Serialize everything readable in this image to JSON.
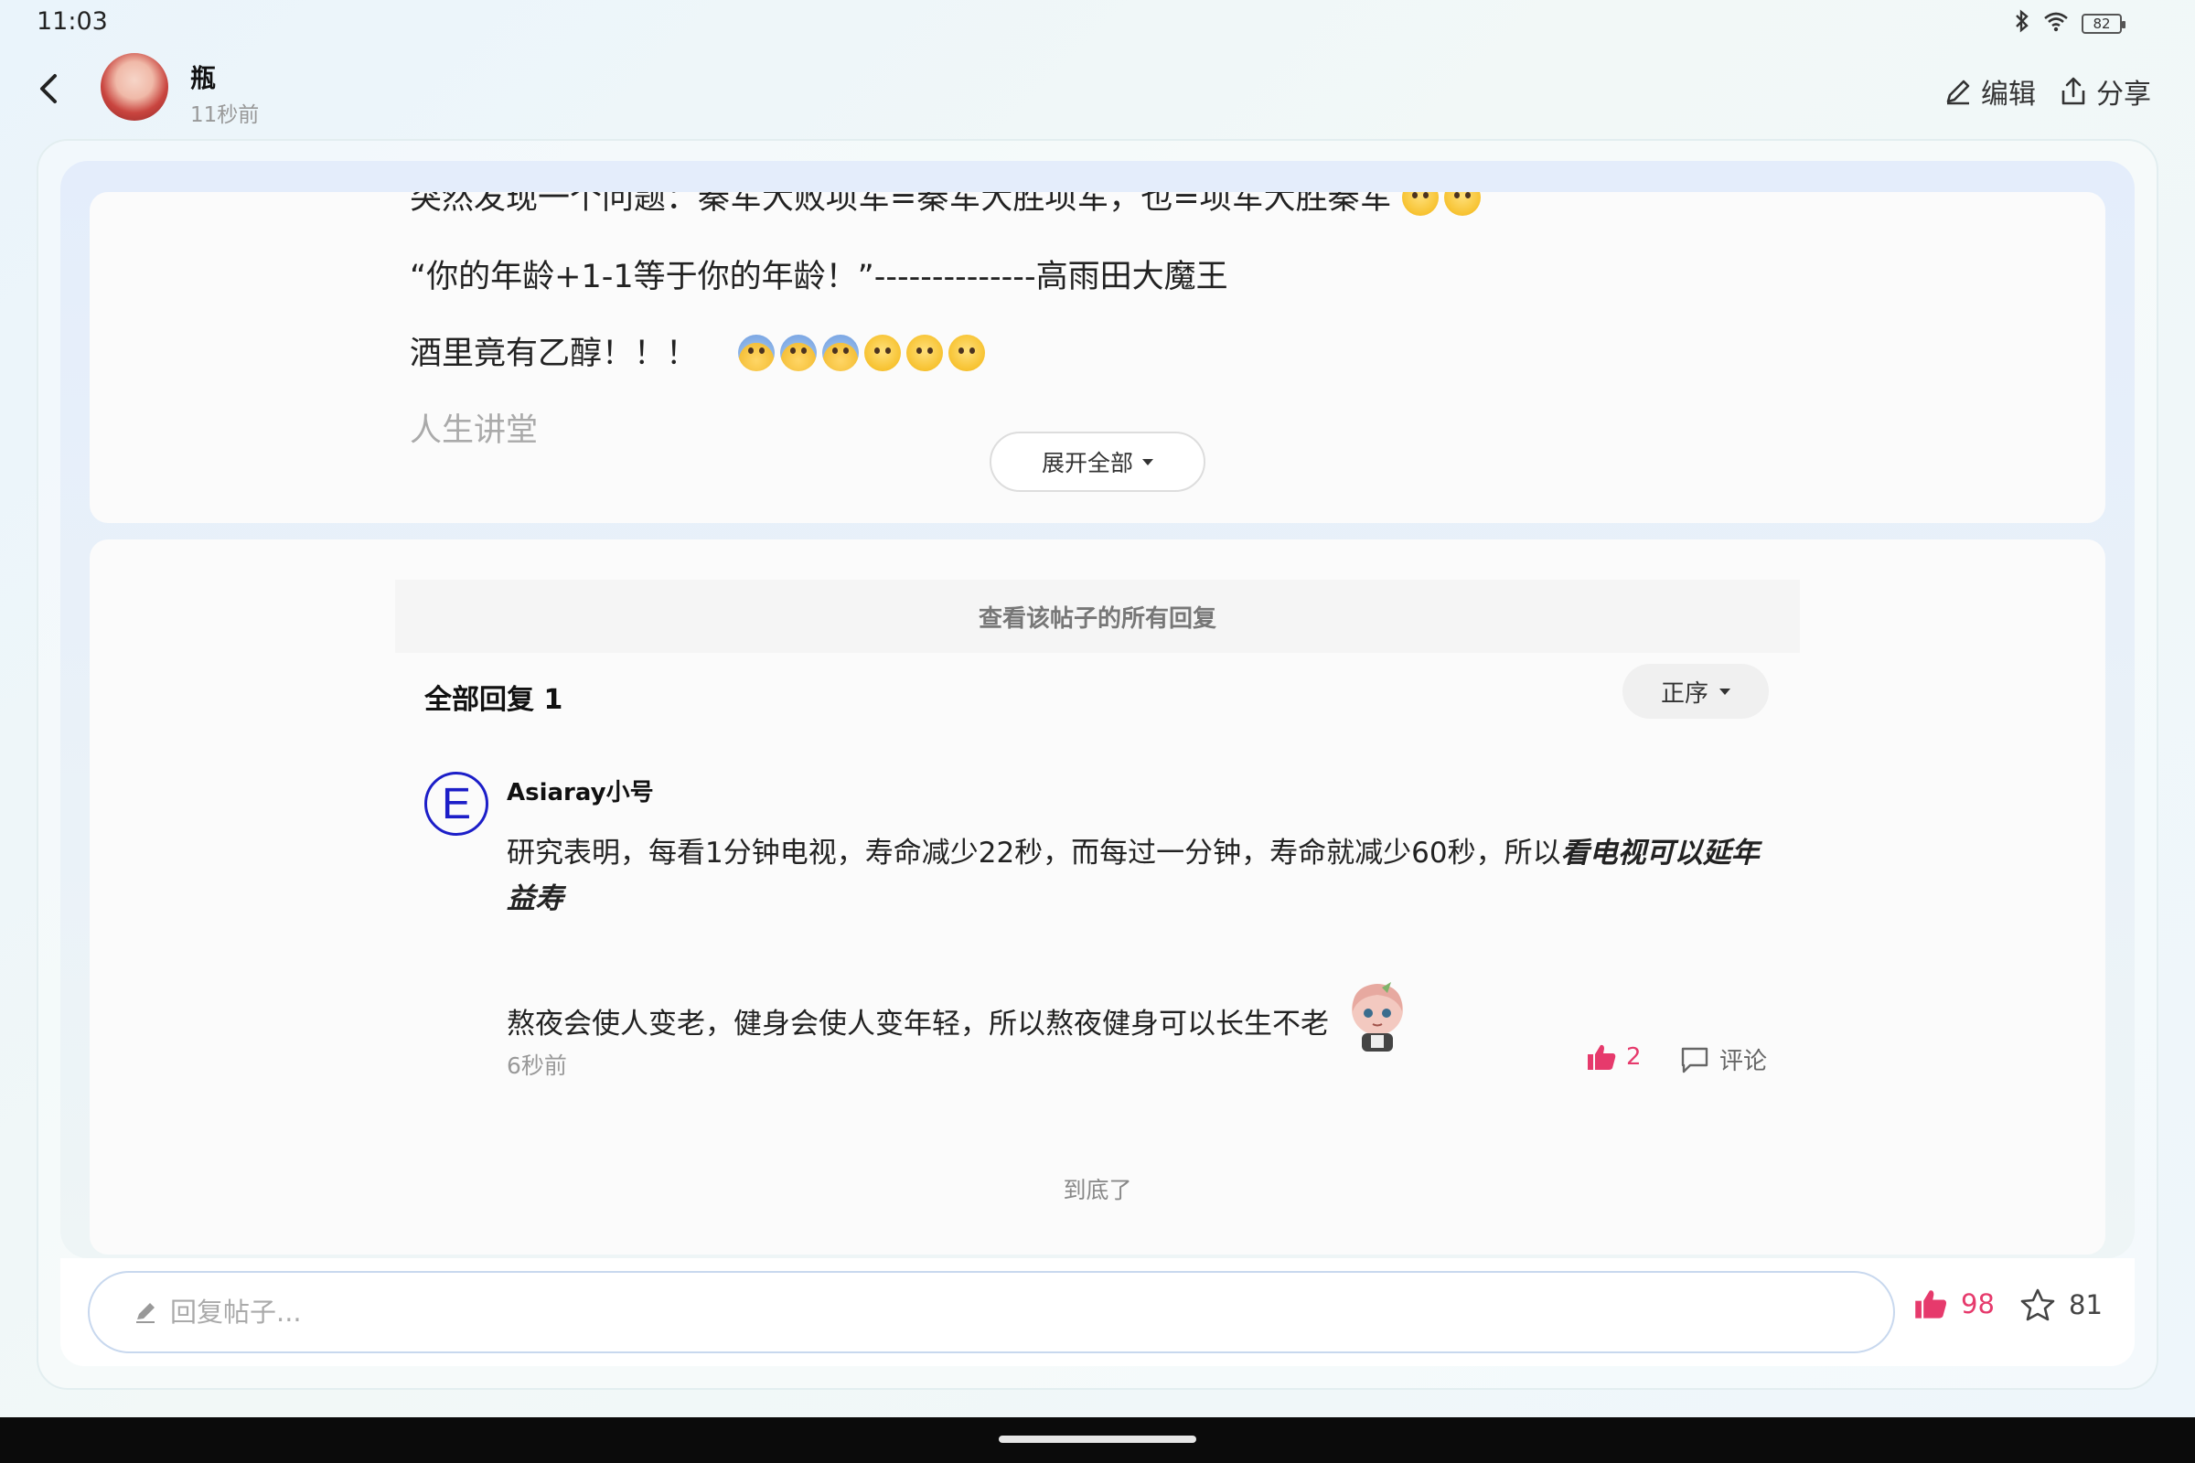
{
  "status_bar": {
    "time": "11:03",
    "battery": "82"
  },
  "header": {
    "author_name": "瓶",
    "post_time": "11秒前",
    "edit_label": "编辑",
    "share_label": "分享"
  },
  "post": {
    "line_clipped": "突然发现一个问题：秦军大败项军=秦军大胜项军，也=项军大胜秦军",
    "line_1": "“你的年龄+1-1等于你的年龄！”--------------高雨田大魔王",
    "line_2": "酒里竟有乙醇！！！",
    "line_faded": "人生讲堂",
    "expand_label": "展开全部"
  },
  "replies": {
    "view_all_label": "查看该帖子的所有回复",
    "title": "全部回复 1",
    "sort_label": "正序",
    "items": [
      {
        "avatar_letter": "E",
        "user": "Asiaray小号",
        "text_normal": "研究表明，每看1分钟电视，寿命减少22秒，而每过一分钟，寿命就减少60秒，所以",
        "text_bold": "看电视可以延年益寿",
        "text_2": "熬夜会使人变老，健身会使人变年轻，所以熬夜健身可以长生不老",
        "time": "6秒前",
        "like_count": "2",
        "comment_label": "评论"
      }
    ],
    "end_label": "到底了"
  },
  "bottom_bar": {
    "input_placeholder": "回复帖子...",
    "like_count": "98",
    "fav_count": "81"
  },
  "colors": {
    "accent_like": "#e63a6c",
    "avatar_ring": "#1c1ec8"
  }
}
